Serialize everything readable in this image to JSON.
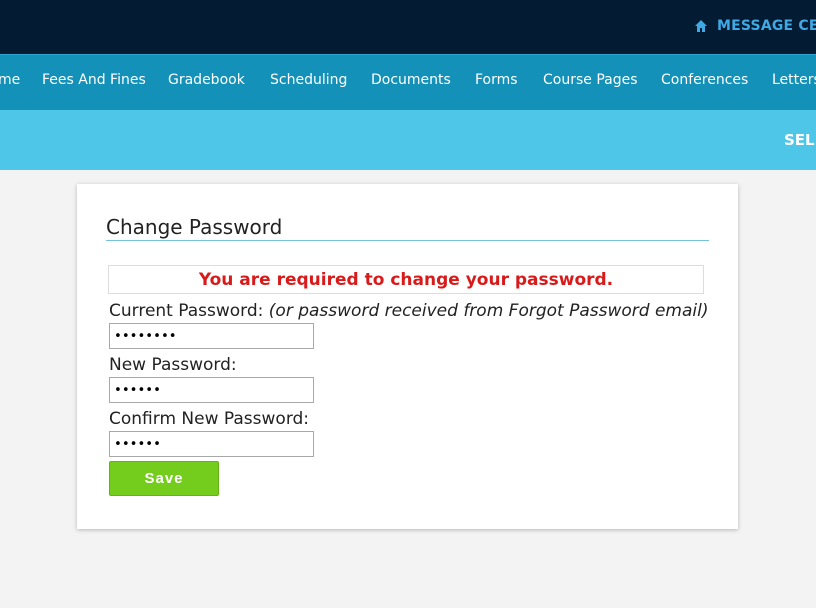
{
  "topbar": {
    "message_center": "MESSAGE CEN"
  },
  "nav": {
    "items": [
      {
        "label": "me"
      },
      {
        "label": "Fees And Fines"
      },
      {
        "label": "Gradebook"
      },
      {
        "label": "Scheduling"
      },
      {
        "label": "Documents"
      },
      {
        "label": "Forms"
      },
      {
        "label": "Course Pages"
      },
      {
        "label": "Conferences"
      },
      {
        "label": "Letters"
      }
    ]
  },
  "subbar": {
    "label": "SELE"
  },
  "form": {
    "title": "Change Password",
    "alert": "You are required to change your password.",
    "current_label": "Current Password:",
    "current_hint": "(or password received from Forgot Password email)",
    "current_value": "••••••••",
    "new_label": "New Password:",
    "new_value": "••••••",
    "confirm_label": "Confirm New Password:",
    "confirm_value": "••••••",
    "save_label": "Save"
  },
  "colors": {
    "topbar": "#041c33",
    "navbar": "#1391b8",
    "subbar": "#4ec6e7",
    "alert": "#d81a1a",
    "save_button": "#74cc1c"
  },
  "icons": {
    "message_center": "home-icon"
  }
}
